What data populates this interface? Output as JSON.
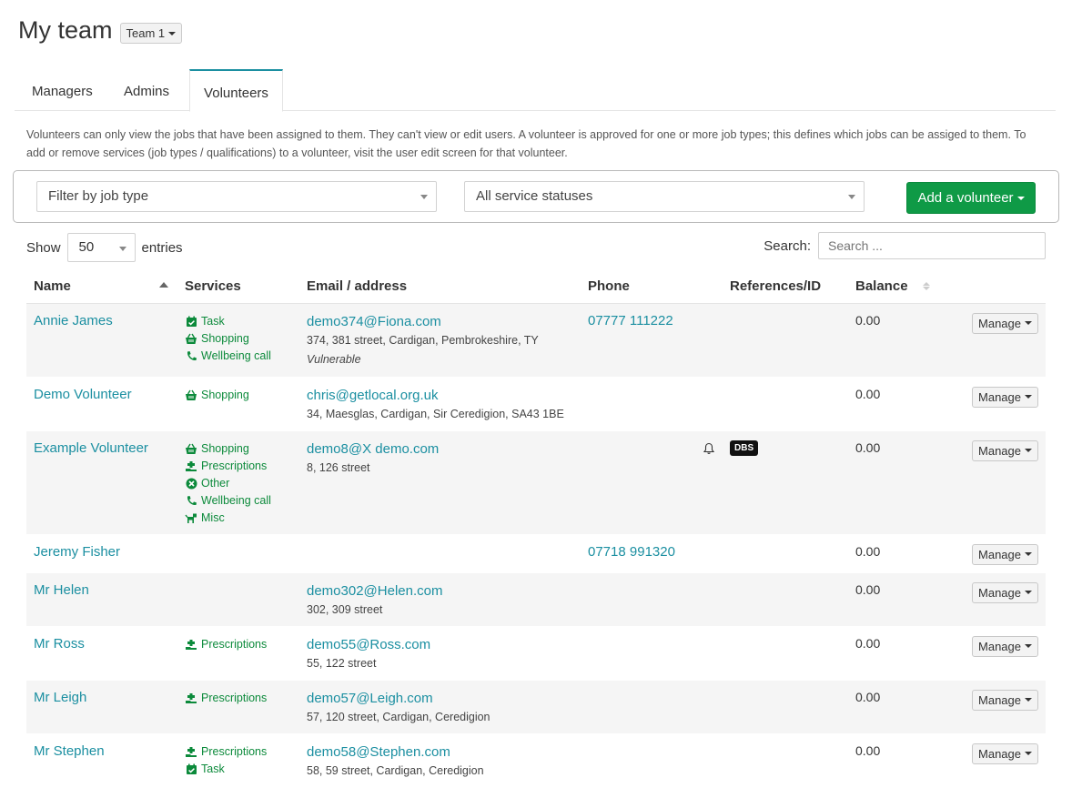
{
  "header": {
    "title": "My team",
    "team_selector": "Team 1"
  },
  "tabs": [
    {
      "label": "Managers"
    },
    {
      "label": "Admins"
    },
    {
      "label": "Volunteers",
      "active": true
    }
  ],
  "intro": "Volunteers can only view the jobs that have been assigned to them. They can't view or edit users. A volunteer is approved for one or more job types; this defines which jobs can be assiged to them. To add or remove services (job types / qualifications) to a volunteer, visit the user edit screen for that volunteer.",
  "filters": {
    "job_type": "Filter by job type",
    "service_status": "All service statuses",
    "add_button": "Add a volunteer"
  },
  "table_controls": {
    "show_label": "Show",
    "page_length": "50",
    "entries_label": "entries",
    "search_label": "Search:",
    "search_placeholder": "Search ..."
  },
  "columns": [
    "Name",
    "Services",
    "Email / address",
    "Phone",
    "References/ID",
    "Balance"
  ],
  "rows": [
    {
      "name": "Annie James",
      "services": [
        {
          "icon": "calendar-check-icon",
          "label": "Task"
        },
        {
          "icon": "basket-icon",
          "label": "Shopping"
        },
        {
          "icon": "phone-icon",
          "label": "Wellbeing call"
        }
      ],
      "email": "demo374@Fiona.com",
      "address": "374, 381 street, Cardigan, Pembrokeshire, TY",
      "note": "Vulnerable",
      "phone": "07777 111222",
      "refs": {
        "bell": false,
        "dbs": ""
      },
      "balance": "0.00",
      "action": "Manage"
    },
    {
      "name": "Demo Volunteer",
      "services": [
        {
          "icon": "basket-icon",
          "label": "Shopping"
        }
      ],
      "email": "chris@getlocal.org.uk",
      "address": "34, Maesglas, Cardigan, Sir Ceredigion, SA43 1BE",
      "note": "",
      "phone": "",
      "refs": {
        "bell": false,
        "dbs": ""
      },
      "balance": "0.00",
      "action": "Manage"
    },
    {
      "name": "Example Volunteer",
      "services": [
        {
          "icon": "basket-icon",
          "label": "Shopping"
        },
        {
          "icon": "prescription-icon",
          "label": "Prescriptions"
        },
        {
          "icon": "cross-circle-icon",
          "label": "Other"
        },
        {
          "icon": "phone-icon",
          "label": "Wellbeing call"
        },
        {
          "icon": "dog-icon",
          "label": "Misc"
        }
      ],
      "email": "demo8@X demo.com",
      "address": "8, 126 street",
      "note": "",
      "phone": "",
      "refs": {
        "bell": true,
        "dbs": "DBS"
      },
      "balance": "0.00",
      "action": "Manage"
    },
    {
      "name": "Jeremy Fisher",
      "services": [],
      "email": "",
      "address": "",
      "note": "",
      "phone": "07718 991320",
      "refs": {
        "bell": false,
        "dbs": ""
      },
      "balance": "0.00",
      "action": "Manage"
    },
    {
      "name": "Mr Helen",
      "services": [],
      "email": "demo302@Helen.com",
      "address": "302, 309 street",
      "note": "",
      "phone": "",
      "refs": {
        "bell": false,
        "dbs": ""
      },
      "balance": "0.00",
      "action": "Manage"
    },
    {
      "name": "Mr Ross",
      "services": [
        {
          "icon": "prescription-icon",
          "label": "Prescriptions"
        }
      ],
      "email": "demo55@Ross.com",
      "address": "55, 122 street",
      "note": "",
      "phone": "",
      "refs": {
        "bell": false,
        "dbs": ""
      },
      "balance": "0.00",
      "action": "Manage"
    },
    {
      "name": "Mr Leigh",
      "services": [
        {
          "icon": "prescription-icon",
          "label": "Prescriptions"
        }
      ],
      "email": "demo57@Leigh.com",
      "address": "57, 120 street, Cardigan, Ceredigion",
      "note": "",
      "phone": "",
      "refs": {
        "bell": false,
        "dbs": ""
      },
      "balance": "0.00",
      "action": "Manage"
    },
    {
      "name": "Mr Stephen",
      "services": [
        {
          "icon": "prescription-icon",
          "label": "Prescriptions"
        },
        {
          "icon": "calendar-check-icon",
          "label": "Task"
        }
      ],
      "email": "demo58@Stephen.com",
      "address": "58, 59 street, Cardigan, Ceredigion",
      "note": "",
      "phone": "",
      "refs": {
        "bell": false,
        "dbs": ""
      },
      "balance": "0.00",
      "action": "Manage"
    }
  ],
  "colors": {
    "link": "#1b8fa1",
    "service_green": "#0c8a3b",
    "add_button": "#0f9a46",
    "active_tab_border": "#1b8fa1"
  }
}
